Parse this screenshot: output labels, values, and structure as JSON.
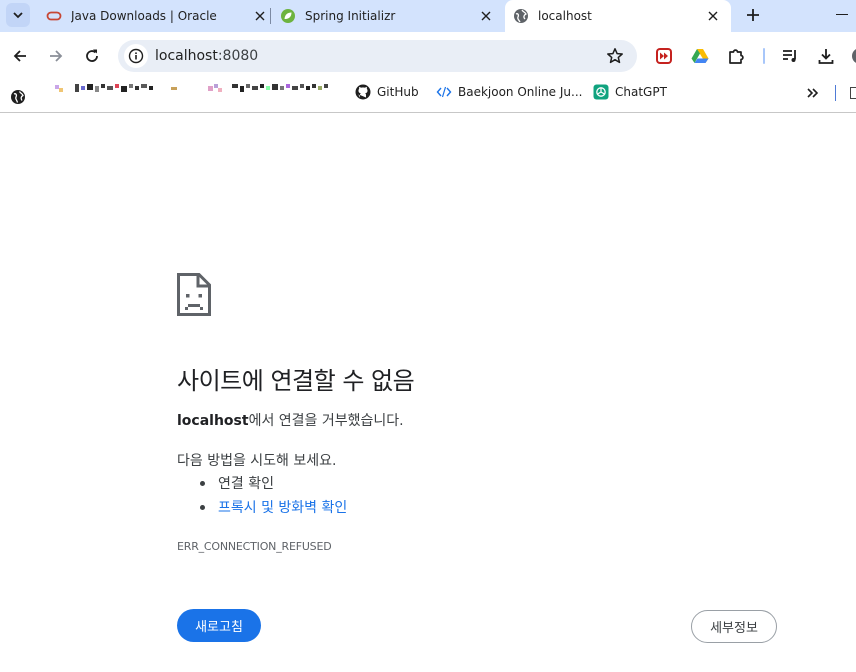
{
  "tabs": [
    {
      "title": "Java Downloads | Oracle",
      "favicon": "oracle-icon",
      "active": false
    },
    {
      "title": "Spring Initializr",
      "favicon": "spring-leaf-icon",
      "active": false
    },
    {
      "title": "localhost",
      "favicon": "globe-icon",
      "active": true
    }
  ],
  "omnibox": {
    "host": "localhost",
    "port": ":8080"
  },
  "bookmarks": [
    {
      "label": "",
      "icon": "globe-bookmark-icon"
    },
    {
      "label": "GitHub",
      "icon": "github-icon"
    },
    {
      "label": "Baekjoon Online Ju...",
      "icon": "code-brackets-icon"
    },
    {
      "label": "ChatGPT",
      "icon": "chatgpt-icon"
    }
  ],
  "error": {
    "heading": "사이트에 연결할 수 없음",
    "host_bold": "localhost",
    "description_rest": "에서 연결을 거부했습니다.",
    "try_text": "다음 방법을 시도해 보세요.",
    "suggestions": [
      "연결 확인",
      "프록시 및 방화벽 확인"
    ],
    "code": "ERR_CONNECTION_REFUSED",
    "reload_label": "새로고침",
    "details_label": "세부정보"
  },
  "colors": {
    "tabstrip": "#d3e3fd",
    "accent": "#1a73e8",
    "omnibox": "#e9eef6"
  }
}
